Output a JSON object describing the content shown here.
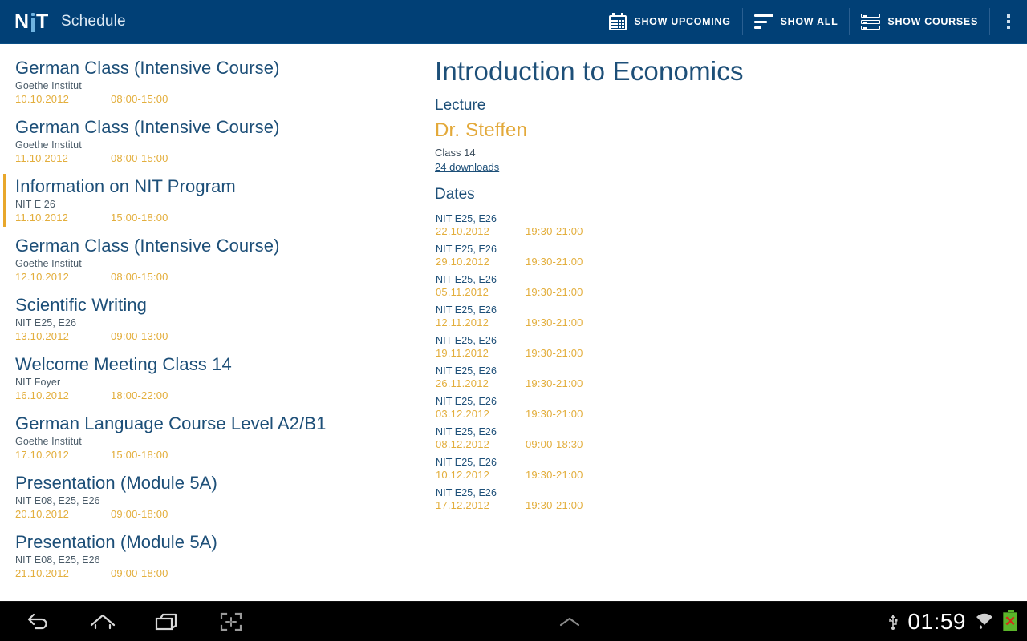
{
  "app": {
    "logo_n": "N",
    "logo_t": "T",
    "title": "Schedule"
  },
  "actionbar": {
    "actions": [
      {
        "icon": "calendar-icon",
        "label": "SHOW UPCOMING"
      },
      {
        "icon": "sort-icon",
        "label": "SHOW ALL"
      },
      {
        "icon": "list-icon",
        "label": "SHOW COURSES"
      }
    ],
    "overflow": "overflow-menu-icon"
  },
  "schedule_list": {
    "items": [
      {
        "title": "German Class (Intensive Course)",
        "venue": "Goethe Institut",
        "date": "10.10.2012",
        "time": "08:00-15:00",
        "selected": false
      },
      {
        "title": "German Class (Intensive Course)",
        "venue": "Goethe Institut",
        "date": "11.10.2012",
        "time": "08:00-15:00",
        "selected": false
      },
      {
        "title": "Information on NIT Program",
        "venue": "NIT E 26",
        "date": "11.10.2012",
        "time": "15:00-18:00",
        "selected": true
      },
      {
        "title": "German Class (Intensive Course)",
        "venue": "Goethe Institut",
        "date": "12.10.2012",
        "time": "08:00-15:00",
        "selected": false
      },
      {
        "title": "Scientific Writing",
        "venue": "NIT E25, E26",
        "date": "13.10.2012",
        "time": "09:00-13:00",
        "selected": false
      },
      {
        "title": "Welcome Meeting Class 14",
        "venue": "NIT Foyer",
        "date": "16.10.2012",
        "time": "18:00-22:00",
        "selected": false
      },
      {
        "title": "German Language Course Level A2/B1",
        "venue": "Goethe Institut",
        "date": "17.10.2012",
        "time": "15:00-18:00",
        "selected": false
      },
      {
        "title": "Presentation (Module 5A)",
        "venue": "NIT E08, E25, E26",
        "date": "20.10.2012",
        "time": "09:00-18:00",
        "selected": false
      },
      {
        "title": "Presentation (Module 5A)",
        "venue": "NIT E08, E25, E26",
        "date": "21.10.2012",
        "time": "09:00-18:00",
        "selected": false
      }
    ]
  },
  "detail": {
    "course_title": "Introduction to Economics",
    "course_type": "Lecture",
    "lecturer": "Dr. Steffen",
    "class": "Class 14",
    "downloads": "24 downloads",
    "dates_header": "Dates",
    "dates": [
      {
        "venue": "NIT E25, E26",
        "date": "22.10.2012",
        "time": "19:30-21:00"
      },
      {
        "venue": "NIT E25, E26",
        "date": "29.10.2012",
        "time": "19:30-21:00"
      },
      {
        "venue": "NIT E25, E26",
        "date": "05.11.2012",
        "time": "19:30-21:00"
      },
      {
        "venue": "NIT E25, E26",
        "date": "12.11.2012",
        "time": "19:30-21:00"
      },
      {
        "venue": "NIT E25, E26",
        "date": "19.11.2012",
        "time": "19:30-21:00"
      },
      {
        "venue": "NIT E25, E26",
        "date": "26.11.2012",
        "time": "19:30-21:00"
      },
      {
        "venue": "NIT E25, E26",
        "date": "03.12.2012",
        "time": "19:30-21:00"
      },
      {
        "venue": "NIT E25, E26",
        "date": "08.12.2012",
        "time": "09:00-18:30"
      },
      {
        "venue": "NIT E25, E26",
        "date": "10.12.2012",
        "time": "19:30-21:00"
      },
      {
        "venue": "NIT E25, E26",
        "date": "17.12.2012",
        "time": "19:30-21:00"
      }
    ]
  },
  "systembar": {
    "nav": [
      "back-icon",
      "home-icon",
      "recents-icon",
      "screenshot-icon"
    ],
    "expand": "chevron-up-icon",
    "clock": "01:59",
    "status_icons": [
      "usb-icon",
      "wifi-icon",
      "battery-error-icon"
    ]
  },
  "colors": {
    "actionbar_bg": "#014076",
    "title_blue": "#1d4f78",
    "accent_gold": "#e3ae3c",
    "selection_bar": "#e8a72b",
    "venue_gray": "#4a5b68",
    "systembar_bg": "#000000"
  }
}
